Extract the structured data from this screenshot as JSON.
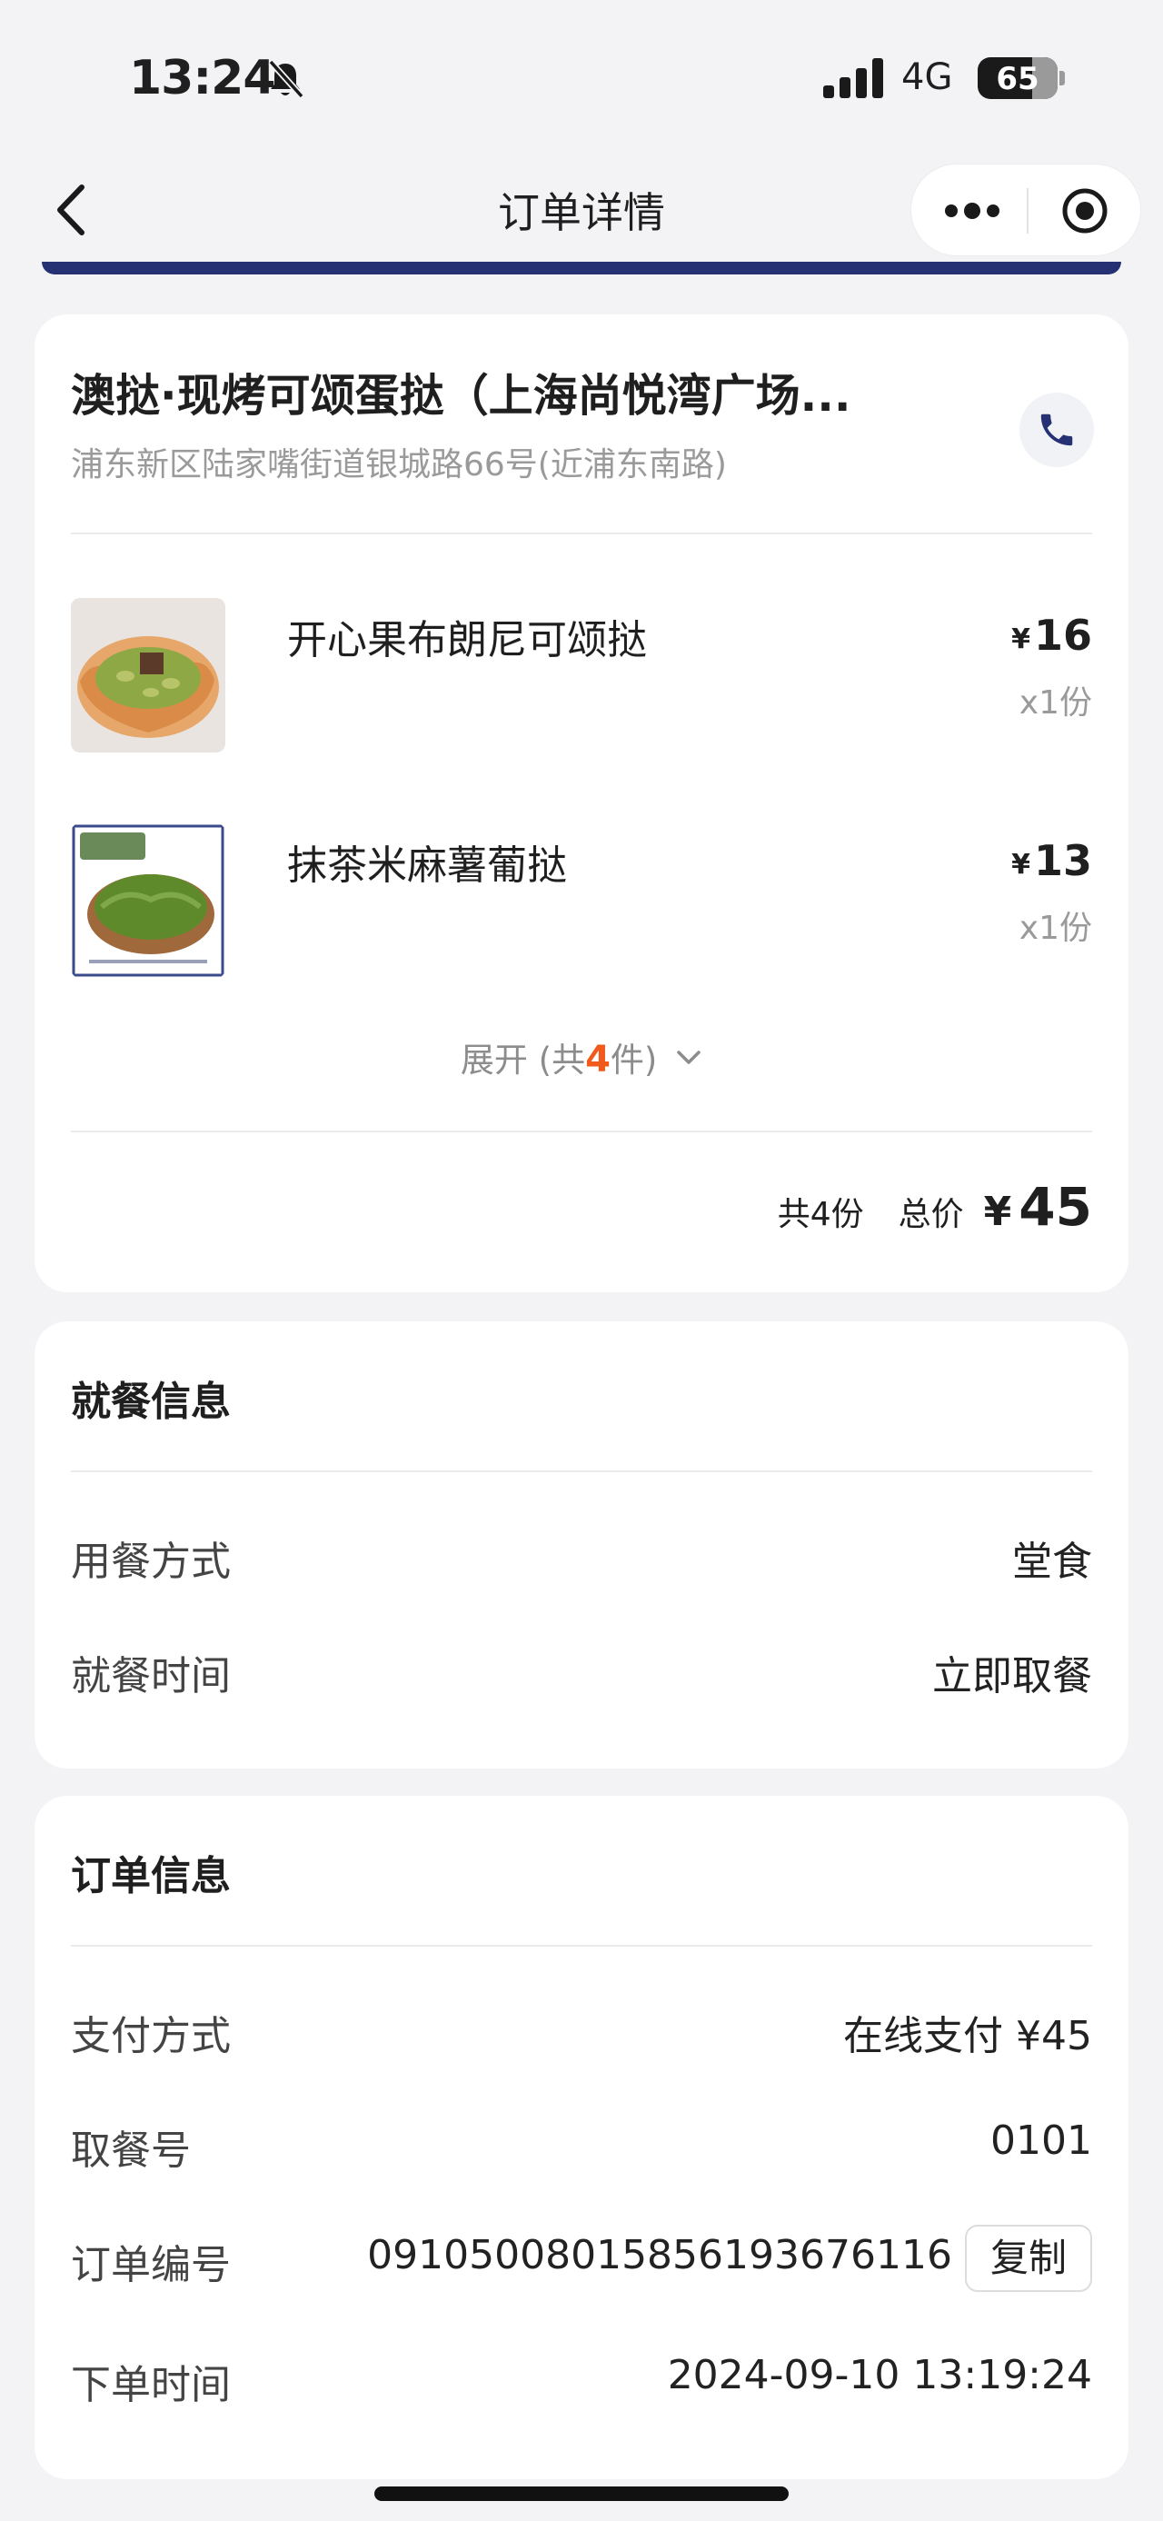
{
  "status_bar": {
    "time": "13:24",
    "network": "4G",
    "battery": "65"
  },
  "nav": {
    "title": "订单详情"
  },
  "store": {
    "name": "澳挞·现烤可颂蛋挞（上海尚悦湾广场...",
    "address": "浦东新区陆家嘴街道银城路66号(近浦东南路)"
  },
  "items": [
    {
      "name": "开心果布朗尼可颂挞",
      "currency": "¥",
      "price": "16",
      "qty": "x1份"
    },
    {
      "name": "抹茶米麻薯葡挞",
      "currency": "¥",
      "price": "13",
      "qty": "x1份"
    }
  ],
  "expand": {
    "prefix": "展开 (共",
    "count": "4",
    "suffix": "件)"
  },
  "total": {
    "count": "共4份",
    "label": "总价",
    "currency": "¥",
    "amount": "45"
  },
  "dining": {
    "title": "就餐信息",
    "rows": [
      {
        "label": "用餐方式",
        "value": "堂食"
      },
      {
        "label": "就餐时间",
        "value": "立即取餐"
      }
    ]
  },
  "order": {
    "title": "订单信息",
    "payment_label": "支付方式",
    "payment_value": "在线支付 ¥45",
    "pickup_label": "取餐号",
    "pickup_value": "0101",
    "number_label": "订单编号",
    "number_value": "09105008015856193676116",
    "copy_label": "复制",
    "time_label": "下单时间",
    "time_value": "2024-09-10 13:19:24"
  },
  "colors": {
    "accent": "#253173",
    "highlight": "#f05a1c",
    "background": "#f3f3f6"
  }
}
